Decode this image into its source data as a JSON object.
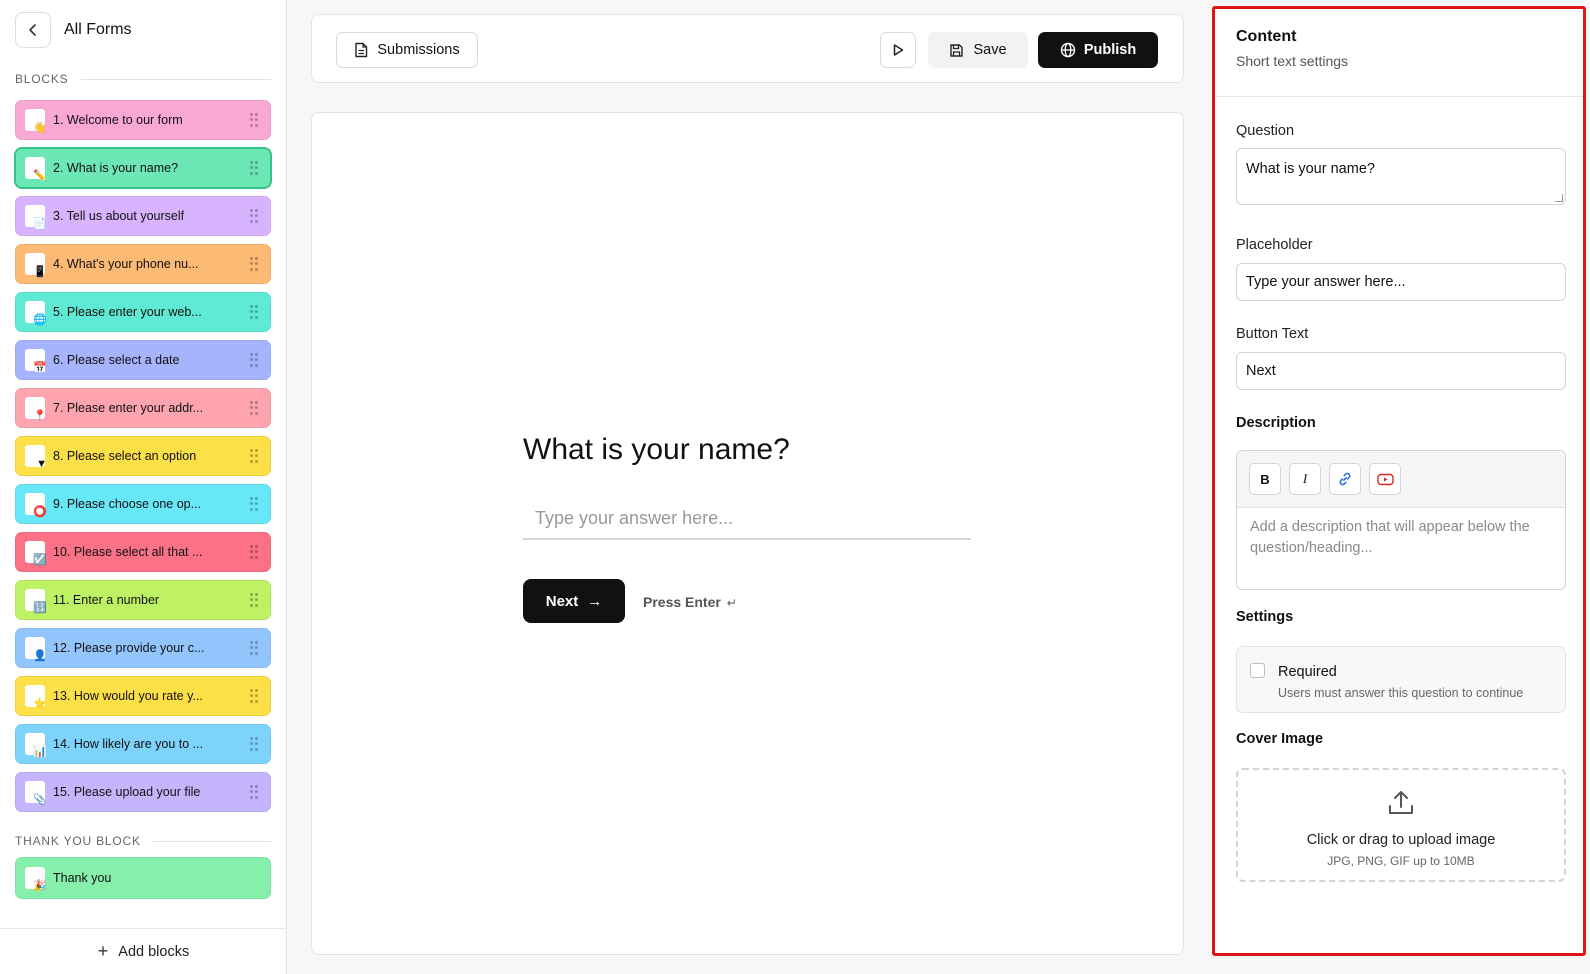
{
  "sidebar": {
    "back_title": "All Forms",
    "blocks_label": "BLOCKS",
    "thankyou_label": "THANK YOU BLOCK",
    "add_blocks": "Add blocks",
    "blocks": [
      {
        "label": "1. Welcome to our form",
        "color": "#f9a8d4",
        "emoji": "👋",
        "active": false
      },
      {
        "label": "2. What is your name?",
        "color": "#6ee7b7",
        "emoji": "✏️",
        "active": true
      },
      {
        "label": "3. Tell us about yourself",
        "color": "#d8b4fe",
        "emoji": "📄",
        "active": false
      },
      {
        "label": "4. What's your phone nu...",
        "color": "#fdba74",
        "emoji": "📱",
        "active": false
      },
      {
        "label": "5. Please enter your web...",
        "color": "#5eead4",
        "emoji": "🌐",
        "active": false
      },
      {
        "label": "6. Please select a date",
        "color": "#a5b4fc",
        "emoji": "📅",
        "active": false
      },
      {
        "label": "7. Please enter your addr...",
        "color": "#fda4af",
        "emoji": "📍",
        "active": false
      },
      {
        "label": "8. Please select an option",
        "color": "#fde047",
        "emoji": "▼",
        "active": false
      },
      {
        "label": "9. Please choose one op...",
        "color": "#67e8f9",
        "emoji": "⭕",
        "active": false
      },
      {
        "label": "10. Please select all that ...",
        "color": "#fb7185",
        "emoji": "☑️",
        "active": false
      },
      {
        "label": "11. Enter a number",
        "color": "#bef264",
        "emoji": "🔢",
        "active": false
      },
      {
        "label": "12. Please provide your c...",
        "color": "#93c5fd",
        "emoji": "👤",
        "active": false
      },
      {
        "label": "13. How would you rate y...",
        "color": "#fde047",
        "emoji": "⭐",
        "active": false
      },
      {
        "label": "14. How likely are you to ...",
        "color": "#7dd3fc",
        "emoji": "📊",
        "active": false
      },
      {
        "label": "15. Please upload your file",
        "color": "#c4b5fd",
        "emoji": "📎",
        "active": false
      }
    ],
    "thankyou": {
      "label": "Thank you",
      "color": "#86efac",
      "emoji": "🎉"
    }
  },
  "toolbar": {
    "submissions": "Submissions",
    "save": "Save",
    "publish": "Publish"
  },
  "preview": {
    "question": "What is your name?",
    "placeholder": "Type your answer here...",
    "next": "Next",
    "next_arrow": "→",
    "press_enter": "Press Enter",
    "enter_glyph": "↵"
  },
  "panel": {
    "title": "Content",
    "subtitle": "Short text settings",
    "question_label": "Question",
    "question_value": "What is your name?",
    "placeholder_label": "Placeholder",
    "placeholder_value": "Type your answer here...",
    "button_text_label": "Button Text",
    "button_text_value": "Next",
    "description_label": "Description",
    "description_placeholder": "Add a description that will appear below the question/heading...",
    "tools": {
      "bold": "B",
      "italic": "I"
    },
    "settings_label": "Settings",
    "required_label": "Required",
    "required_sub": "Users must answer this question to continue",
    "cover_label": "Cover Image",
    "upload_title": "Click or drag to upload image",
    "upload_sub": "JPG, PNG, GIF up to 10MB"
  }
}
